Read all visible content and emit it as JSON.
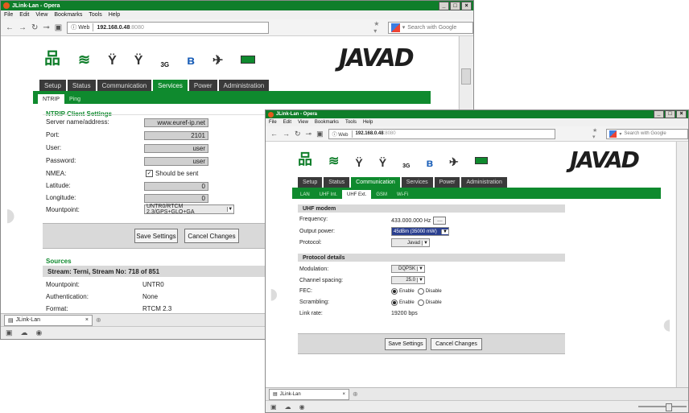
{
  "back_window": {
    "title": "JLink-Lan - Opera",
    "menu": [
      "File",
      "Edit",
      "View",
      "Bookmarks",
      "Tools",
      "Help"
    ],
    "address": {
      "web_label": "Web",
      "url": "192.168.0.48",
      "port": ":8080"
    },
    "search_placeholder": "Search with Google",
    "logo": "JAVAD",
    "icons_3g_label": "3G",
    "tabs": [
      "Setup",
      "Status",
      "Communication",
      "Services",
      "Power",
      "Administration"
    ],
    "active_tab": "Services",
    "subtabs": [
      "NTRIP",
      "Ping"
    ],
    "active_subtab": "NTRIP",
    "section_title": "NTRIP Client Settings",
    "fields": {
      "server_label": "Server name/address:",
      "server_value": "www.euref-ip.net",
      "port_label": "Port:",
      "port_value": "2101",
      "user_label": "User:",
      "user_value": "user",
      "password_label": "Password:",
      "password_value": "user",
      "nmea_label": "NMEA:",
      "nmea_value": "Should be sent",
      "latitude_label": "Latitude:",
      "latitude_value": "0",
      "longitude_label": "Longitude:",
      "longitude_value": "0",
      "mountpoint_label": "Mountpoint:",
      "mountpoint_value": "UNTR0/RTCM 2.3/GPS+GLO+GA"
    },
    "save_label": "Save Settings",
    "cancel_label": "Cancel Changes",
    "sources_title": "Sources",
    "stream_header": "Stream: Terni, Stream No: 718 of 851",
    "details": [
      {
        "label": "Mountpoint:",
        "value": "UNTR0"
      },
      {
        "label": "Authentication:",
        "value": "None"
      },
      {
        "label": "Format:",
        "value": "RTCM 2.3"
      }
    ],
    "page_tab": "JLink-Lan"
  },
  "front_window": {
    "title": "JLink-Lan - Opera",
    "menu": [
      "File",
      "Edit",
      "View",
      "Bookmarks",
      "Tools",
      "Help"
    ],
    "address": {
      "web_label": "Web",
      "url": "192.168.0.48",
      "port": ":8080"
    },
    "search_placeholder": "Search with Google",
    "logo": "JAVAD",
    "icons_3g_label": "3G",
    "tabs": [
      "Setup",
      "Status",
      "Communication",
      "Services",
      "Power",
      "Administration"
    ],
    "active_tab": "Communication",
    "subtabs": [
      "LAN",
      "UHF Int.",
      "UHF Ext.",
      "GSM",
      "Wi-Fi"
    ],
    "active_subtab": "UHF Ext.",
    "uhf_section": "UHF modem",
    "frequency_label": "Frequency:",
    "frequency_value": "433.000.000 Hz",
    "frequency_btn": "....",
    "output_label": "Output power:",
    "output_value": "45dBm (35000 mW)",
    "protocol_label": "Protocol:",
    "protocol_value": "Javad",
    "protocol_section": "Protocol details",
    "modulation_label": "Modulation:",
    "modulation_value": "DQPSK",
    "spacing_label": "Channel spacing:",
    "spacing_value": "25.0",
    "fec_label": "FEC:",
    "scrambling_label": "Scrambling:",
    "enable_label": "Enable",
    "disable_label": "Disable",
    "fec_state": "Enable",
    "scrambling_state": "Enable",
    "linkrate_label": "Link rate:",
    "linkrate_value": "19200 bps",
    "save_label": "Save Settings",
    "cancel_label": "Cancel Changes",
    "page_tab": "JLink-Lan"
  },
  "colors": {
    "brand_green": "#0f8a2e",
    "tab_dark": "#3a3a3a",
    "titlebar_green": "#0f7e2a"
  }
}
